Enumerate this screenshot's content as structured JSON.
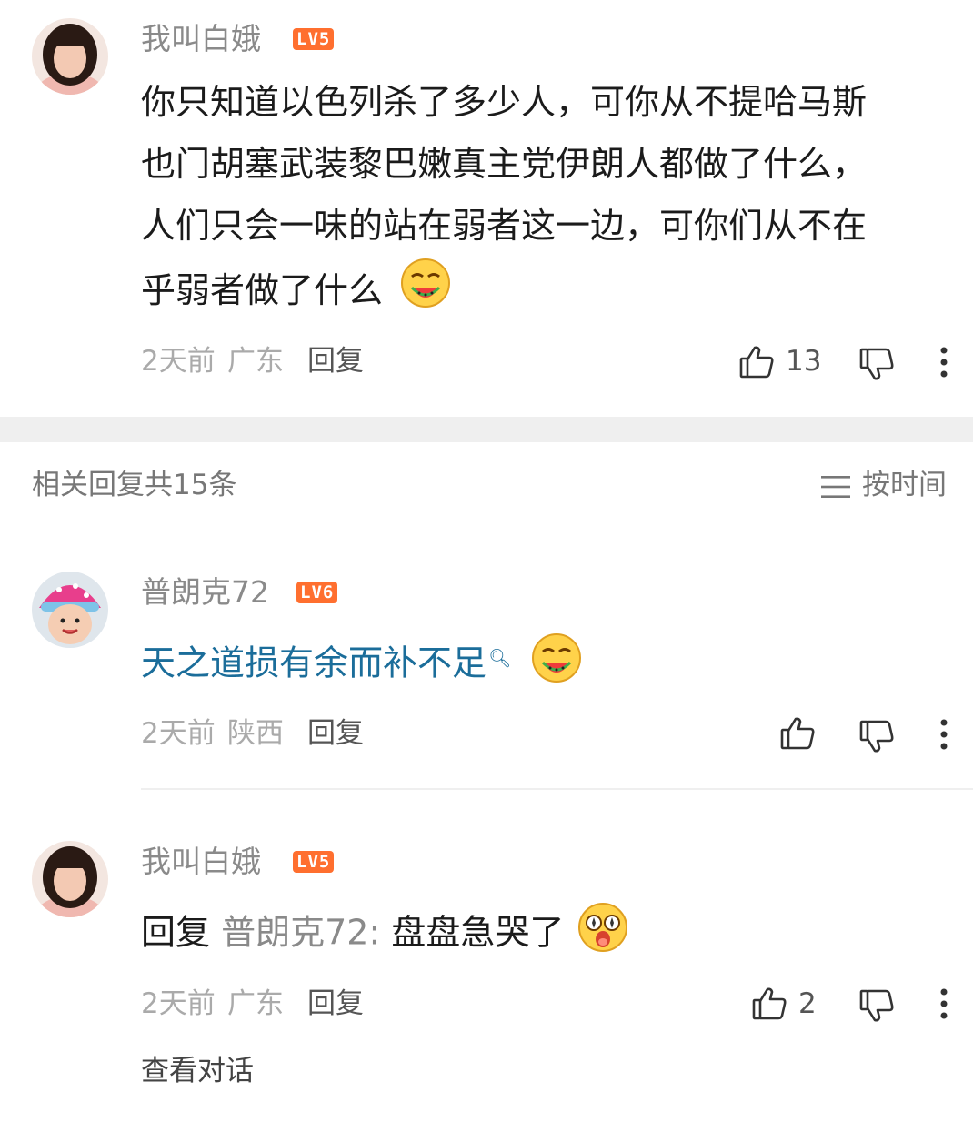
{
  "main_comment": {
    "user": "我叫白娥",
    "level": "LV5",
    "text_lines": [
      "你只知道以色列杀了多少人，可你从不提哈马斯",
      "也门胡塞武装黎巴嫩真主党伊朗人都做了什么，",
      "人们只会一味的站在弱者这一边，可你们从不在",
      "乎弱者做了什么"
    ],
    "time": "2天前",
    "location": "广东",
    "reply_label": "回复",
    "likes": "13"
  },
  "replies_header": {
    "count_label": "相关回复共15条",
    "sort_label": "按时间"
  },
  "reply1": {
    "user": "普朗克72",
    "level": "LV6",
    "text": "天之道损有余而补不足",
    "time": "2天前",
    "location": "陕西",
    "reply_label": "回复"
  },
  "reply2": {
    "user": "我叫白娥",
    "level": "LV5",
    "reply_prefix": "回复",
    "reply_target": "普朗克72:",
    "text": "盘盘急哭了",
    "time": "2天前",
    "location": "广东",
    "reply_label": "回复",
    "likes": "2",
    "view_conversation": "查看对话"
  },
  "colors": {
    "level_badge": "#ff6f2f",
    "link": "#1b6d9a",
    "divider": "#efefef"
  }
}
